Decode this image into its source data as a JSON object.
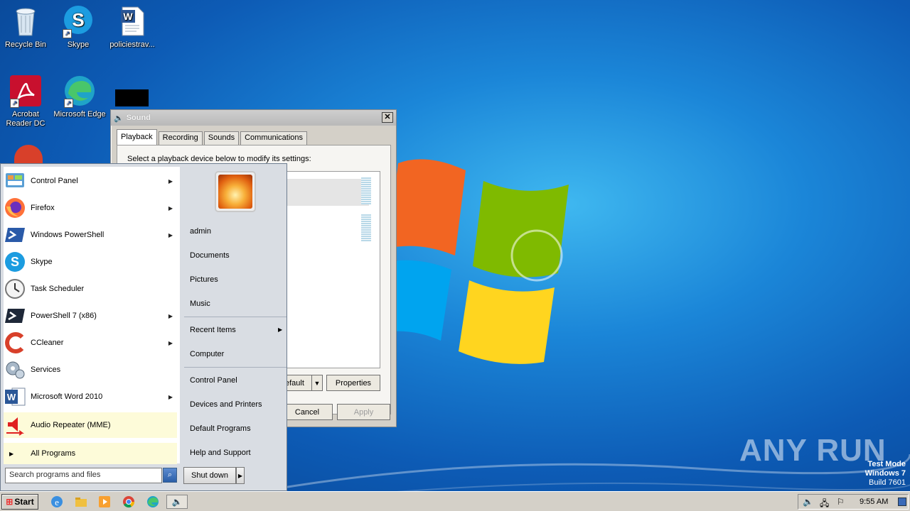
{
  "desktop": {
    "icons": [
      {
        "label": "Recycle Bin",
        "icon": "recycle-bin-icon"
      },
      {
        "label": "Skype",
        "icon": "skype-icon"
      },
      {
        "label": "policiestrav...",
        "icon": "word-document-icon"
      },
      {
        "label": "Acrobat Reader DC",
        "icon": "acrobat-icon"
      },
      {
        "label": "Microsoft Edge",
        "icon": "edge-icon"
      }
    ]
  },
  "sound_dialog": {
    "title": "Sound",
    "tabs": [
      "Playback",
      "Recording",
      "Sounds",
      "Communications"
    ],
    "active_tab": "Playback",
    "instruction": "Select a playback device below to modify its settings:",
    "buttons": {
      "set_default": "efault",
      "properties": "Properties",
      "cancel": "Cancel",
      "apply": "Apply"
    }
  },
  "start_menu": {
    "programs": [
      {
        "label": "Control Panel",
        "icon": "control-panel-icon",
        "submenu": true
      },
      {
        "label": "Firefox",
        "icon": "firefox-icon",
        "submenu": true
      },
      {
        "label": "Windows PowerShell",
        "icon": "powershell-icon",
        "submenu": true
      },
      {
        "label": "Skype",
        "icon": "skype-icon",
        "submenu": false
      },
      {
        "label": "Task Scheduler",
        "icon": "task-scheduler-icon",
        "submenu": false
      },
      {
        "label": "PowerShell 7 (x86)",
        "icon": "powershell7-icon",
        "submenu": true
      },
      {
        "label": "CCleaner",
        "icon": "ccleaner-icon",
        "submenu": true
      },
      {
        "label": "Services",
        "icon": "services-icon",
        "submenu": false
      },
      {
        "label": "Microsoft Word 2010",
        "icon": "word-icon",
        "submenu": true
      },
      {
        "label": "Audio Repeater (MME)",
        "icon": "audio-repeater-icon",
        "submenu": false,
        "highlighted": true
      }
    ],
    "all_programs": "All Programs",
    "search_placeholder": "Search programs and files",
    "right_items": {
      "user": "admin",
      "documents": "Documents",
      "pictures": "Pictures",
      "music": "Music",
      "recent_items": "Recent Items",
      "computer": "Computer",
      "control_panel": "Control Panel",
      "devices_printers": "Devices and Printers",
      "default_programs": "Default Programs",
      "help_support": "Help and Support"
    },
    "shutdown": "Shut down"
  },
  "taskbar": {
    "start_label": "Start",
    "pinned": [
      "ie-icon",
      "explorer-icon",
      "media-player-icon",
      "chrome-icon",
      "edge-icon",
      "sound-icon"
    ],
    "clock": "9:55 AM"
  },
  "watermark": {
    "test_mode": "Test Mode",
    "os": "Windows 7",
    "build": "Build 7601",
    "brand": "ANY RUN"
  },
  "colors": {
    "desktop_blue": "#0d5bb5",
    "start_highlight": "#fdfbd9",
    "dialog_face": "#d4d0c8"
  }
}
